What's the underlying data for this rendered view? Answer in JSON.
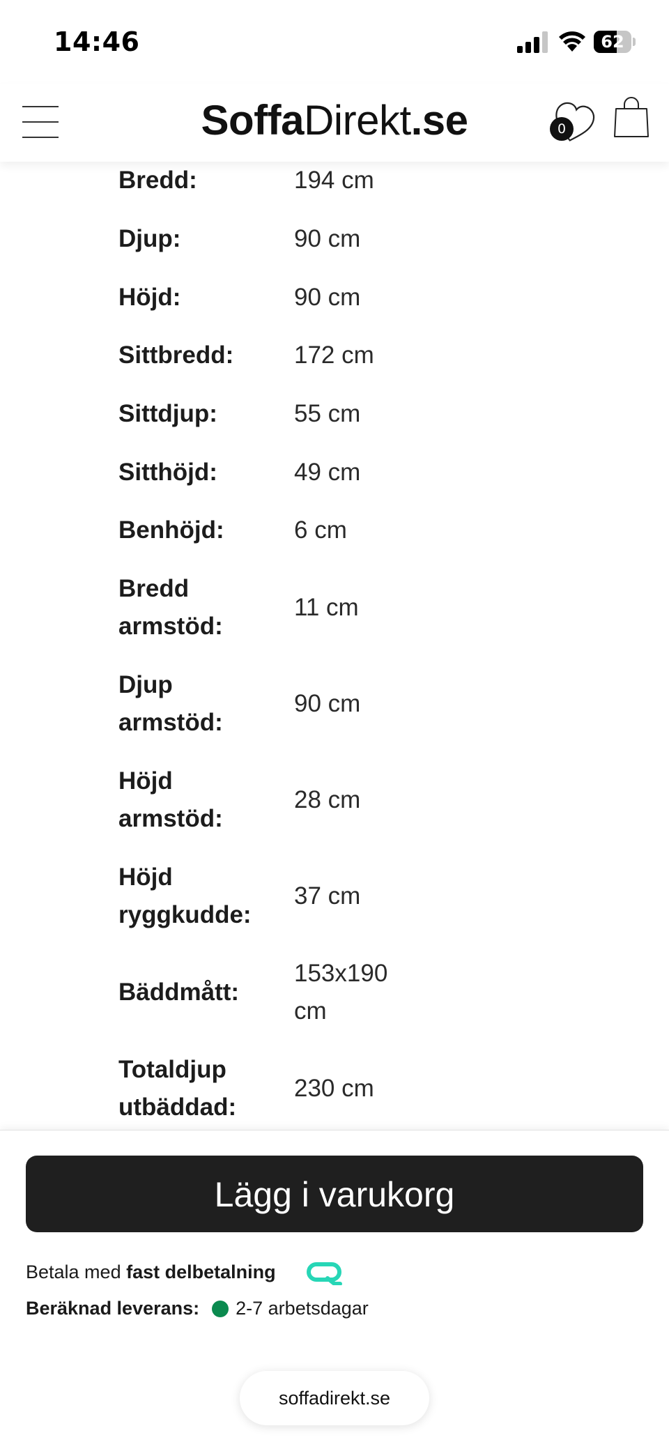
{
  "status_bar": {
    "time": "14:46",
    "battery_level": "62",
    "battery_fraction": 0.62
  },
  "header": {
    "logo_bold": "Soffa",
    "logo_regular": "Direkt",
    "logo_suffix": ".se",
    "wishlist_count": "0",
    "icons": [
      "menu-icon",
      "heart-icon",
      "shopping-bag-icon"
    ]
  },
  "specs": [
    {
      "label": "Bredd:",
      "value": "194 cm"
    },
    {
      "label": "Djup:",
      "value": "90 cm"
    },
    {
      "label": "Höjd:",
      "value": "90 cm"
    },
    {
      "label": "Sittbredd:",
      "value": "172 cm"
    },
    {
      "label": "Sittdjup:",
      "value": "55 cm"
    },
    {
      "label": "Sitthöjd:",
      "value": "49 cm"
    },
    {
      "label": "Benhöjd:",
      "value": "6 cm"
    },
    {
      "label": "Bredd armstöd:",
      "value": "11 cm"
    },
    {
      "label": "Djup armstöd:",
      "value": "90 cm"
    },
    {
      "label": "Höjd armstöd:",
      "value": "28 cm"
    },
    {
      "label": "Höjd ryggkudde:",
      "value": "37 cm"
    },
    {
      "label": "Bäddmått:",
      "value": "153x190 cm"
    },
    {
      "label": "Totaldjup utbäddad:",
      "value": "230 cm"
    }
  ],
  "bottom": {
    "add_to_cart_label": "Lägg i varukorg",
    "payment_prefix": "Betala med",
    "payment_bold": "fast delbetalning",
    "delivery_label": "Beräknad leverans:",
    "delivery_value": "2-7 arbetsdagar",
    "delivery_status_color": "#0b8a4f",
    "url": "soffadirekt.se"
  }
}
